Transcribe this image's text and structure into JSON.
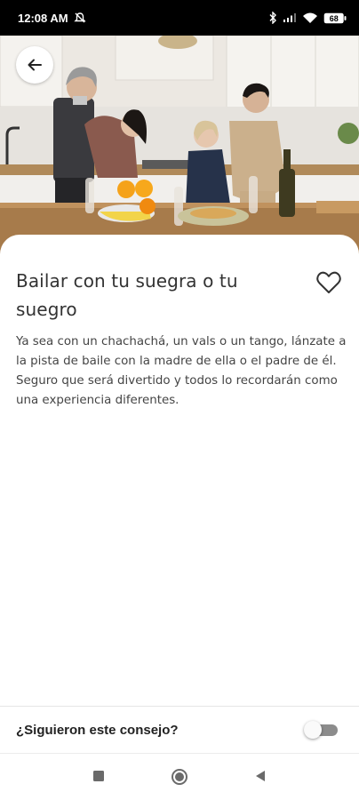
{
  "status_bar": {
    "time": "12:08 AM",
    "icons": [
      "mute-notifications-icon",
      "bluetooth-icon",
      "signal-icon",
      "wifi-icon",
      "battery-icon"
    ],
    "battery_level": "68"
  },
  "hero": {
    "image": "two couples dancing in a kitchen",
    "back_icon": "arrow-left-icon"
  },
  "tip": {
    "title": "Bailar con tu suegra o tu suegro",
    "description": "Ya sea con un chachachá, un vals o un tango, lánzate a la pista de baile con la madre de ella o el padre de él. Seguro que será divertido y todos lo recordarán como una experiencia diferentes.",
    "favorite_icon": "heart-outline-icon"
  },
  "feedback": {
    "question": "¿Siguieron este consejo?",
    "toggle_on": false
  },
  "nav_bar": {
    "icons": [
      "recent-apps-icon",
      "home-icon",
      "back-icon"
    ]
  },
  "colors": {
    "status_bar_bg": "#000000",
    "card_bg": "#ffffff",
    "toggle_track": "#8c8c8c"
  }
}
